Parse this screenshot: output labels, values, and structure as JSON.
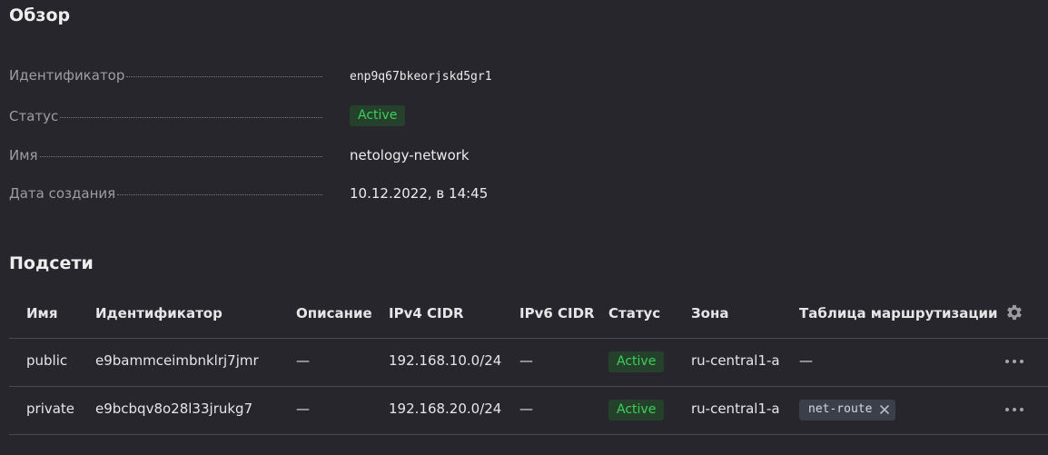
{
  "overview": {
    "title": "Обзор",
    "properties": [
      {
        "label": "Идентификатор",
        "value": "enp9q67bkeorjskd5gr1"
      },
      {
        "label": "Статус",
        "value": "Active"
      },
      {
        "label": "Имя",
        "value": "netology-network"
      },
      {
        "label": "Дата создания",
        "value": "10.12.2022, в 14:45"
      }
    ]
  },
  "subnets": {
    "title": "Подсети",
    "columns": [
      "Имя",
      "Идентификатор",
      "Описание",
      "IPv4 CIDR",
      "IPv6 CIDR",
      "Статус",
      "Зона",
      "Таблица маршрутизации"
    ],
    "rows": [
      {
        "name": "public",
        "id": "e9bammceimbnklrj7jmr",
        "description": "—",
        "ipv4": "192.168.10.0/24",
        "ipv6": "—",
        "status": "Active",
        "zone": "ru-central1-a",
        "route_table": "—"
      },
      {
        "name": "private",
        "id": "e9bcbqv8o28l33jrukg7",
        "description": "—",
        "ipv4": "192.168.20.0/24",
        "ipv6": "—",
        "status": "Active",
        "zone": "ru-central1-a",
        "route_table": "net-route"
      }
    ],
    "settings_icon": "gear-icon",
    "row_menu_icon": "more-horizontal-icon"
  },
  "colors": {
    "background": "#27262c",
    "status_active_text": "#3ccf5a",
    "status_active_bg": "#26412b"
  }
}
